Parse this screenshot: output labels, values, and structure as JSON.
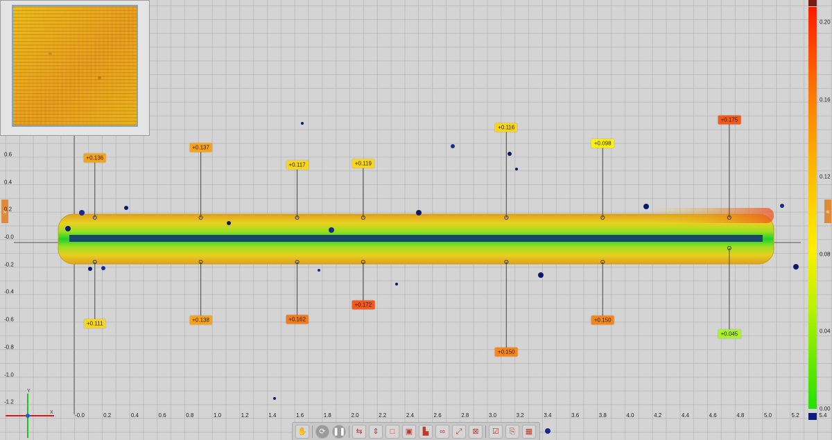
{
  "x_ticks": [
    "-0.0",
    "0.2",
    "0.4",
    "0.6",
    "0.8",
    "1.0",
    "1.2",
    "1.4",
    "1.6",
    "1.8",
    "2.0",
    "2.2",
    "2.4",
    "2.6",
    "2.8",
    "3.0",
    "3.2",
    "3.4",
    "3.6",
    "3.8",
    "4.0",
    "4.2",
    "4.4",
    "4.6",
    "4.8",
    "5.0",
    "5.2",
    "5.4"
  ],
  "y_ticks": [
    "0.6",
    "0.4",
    "0.2",
    "-0.0",
    "-0.2",
    "-0.4",
    "-0.6",
    "-0.8",
    "-1.0",
    "-1.2"
  ],
  "colorbar": {
    "ticks": [
      "0.20",
      "0.16",
      "0.12",
      "0.08",
      "0.04",
      "0.00"
    ]
  },
  "callouts_top": [
    {
      "label": "+0.136",
      "x": 0.15,
      "color": "#f7a21b"
    },
    {
      "label": "+0.137",
      "x": 0.92,
      "color": "#f7a21b"
    },
    {
      "label": "+0.117",
      "x": 1.62,
      "color": "#fbd51a"
    },
    {
      "label": "+0.119",
      "x": 2.1,
      "color": "#fbd51a"
    },
    {
      "label": "+0.116",
      "x": 3.14,
      "color": "#fbd51a"
    },
    {
      "label": "+0.098",
      "x": 3.84,
      "color": "#fff200"
    },
    {
      "label": "+0.175",
      "x": 4.76,
      "color": "#f25a1c"
    }
  ],
  "callouts_bottom": [
    {
      "label": "+0.111",
      "x": 0.15,
      "color": "#fbd51a"
    },
    {
      "label": "+0.138",
      "x": 0.92,
      "color": "#f7a21b"
    },
    {
      "label": "+0.162",
      "x": 1.62,
      "color": "#f27a1a"
    },
    {
      "label": "+0.172",
      "x": 2.1,
      "color": "#f25a1c"
    },
    {
      "label": "+0.150",
      "x": 3.14,
      "color": "#f7861a"
    },
    {
      "label": "+0.150",
      "x": 3.84,
      "color": "#f7861a"
    },
    {
      "label": "+0.045",
      "x": 4.76,
      "color": "#a8f22c"
    }
  ],
  "axis_labels": {
    "x": "X",
    "y": "Y"
  },
  "toolbar": {
    "buttons": [
      "hand-icon",
      "rotate-icon",
      "pause-icon",
      "measure-icon",
      "align-icon",
      "box-icon",
      "region-icon",
      "chart-icon",
      "link-icon",
      "expand-icon",
      "fit-icon",
      "report-icon",
      "export-icon",
      "screenshot-icon"
    ]
  }
}
